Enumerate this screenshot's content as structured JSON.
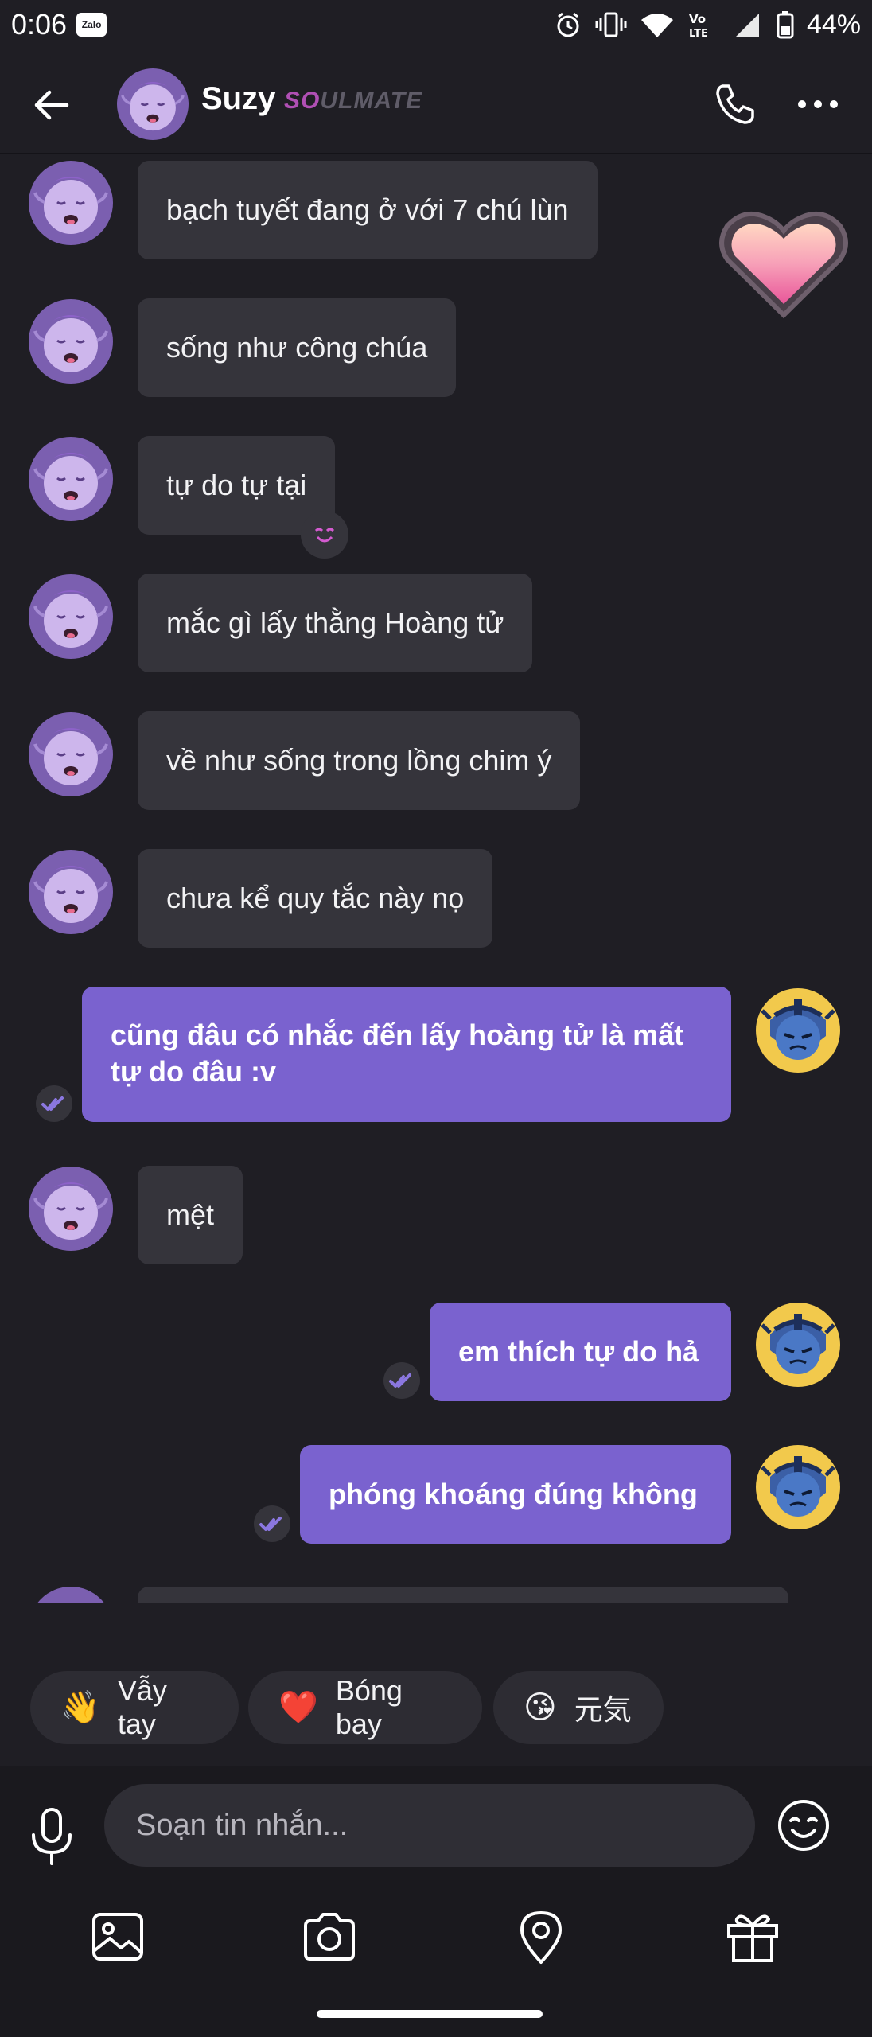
{
  "status_bar": {
    "time": "0:06",
    "zalo": "Zalo",
    "battery": "44%"
  },
  "header": {
    "name": "Suzy",
    "badge_so": "SO",
    "badge_rest": "ULMATE"
  },
  "messages": [
    {
      "text": "bạch tuyết đang ở với 7 chú lùn"
    },
    {
      "text": "sống như công chúa"
    },
    {
      "text": "tự do tự tại"
    },
    {
      "text": "mắc gì lấy thằng Hoàng tử"
    },
    {
      "text": "về như sống trong lồng chim ý"
    },
    {
      "text": "chưa kể quy tắc này nọ"
    },
    {
      "text": "cũng đâu có nhắc đến lấy hoàng tử là mất tự do đâu :v"
    },
    {
      "text": "mệt"
    },
    {
      "text": "em thích tự do hả"
    },
    {
      "text": "phóng khoáng đúng không"
    }
  ],
  "quick_replies": [
    {
      "icon": "👋",
      "label": "Vẫy tay"
    },
    {
      "icon": "❤️",
      "label": "Bóng bay"
    },
    {
      "icon": "😘",
      "label": "元気"
    }
  ],
  "composer": {
    "placeholder": "Soạn tin nhắn..."
  },
  "colors": {
    "background": "#1f1e24",
    "incoming_bubble": "#35343b",
    "outgoing_bubble": "#7a62cf",
    "accent": "#b04fb4"
  }
}
